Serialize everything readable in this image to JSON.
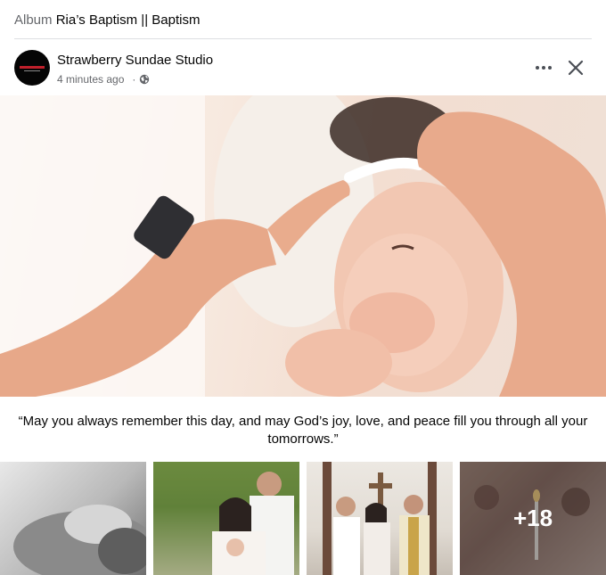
{
  "album": {
    "prefix": "Album",
    "title": "Ria’s Baptism || Baptism"
  },
  "post": {
    "author": "Strawberry Sundae Studio",
    "timestamp": "4 minutes ago",
    "separator": "·",
    "privacy_icon": "globe-icon",
    "more_icon": "more-horizontal-icon",
    "close_icon": "close-icon"
  },
  "caption": "“May you always remember this day, and may God’s joy, love, and peace fill you through all your tomorrows.”",
  "thumbnails": {
    "more_count": "+18"
  },
  "colors": {
    "text_primary": "#050505",
    "text_secondary": "#65676b",
    "divider": "#dddfe2"
  }
}
